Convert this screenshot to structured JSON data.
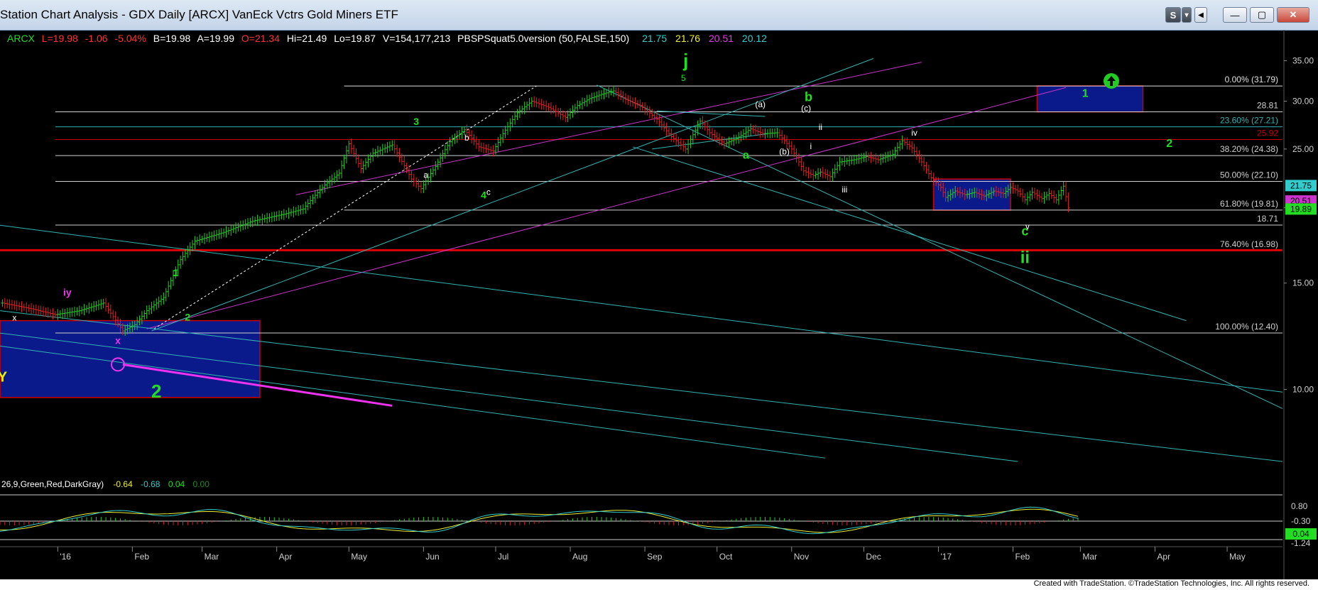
{
  "window": {
    "title": "Station Chart Analysis - GDX Daily [ARCX] VanEck Vctrs Gold Miners ETF",
    "buttons": {
      "s": "S",
      "dd": "▾",
      "back": "◀",
      "minimize": "—",
      "maximize": "▢",
      "close": "✕"
    }
  },
  "legend": {
    "symbol": "ARCX",
    "last": "L=19.98",
    "change": "-1.06",
    "pct": "-5.04%",
    "bid": "B=19.98",
    "ask": "A=19.99",
    "open": "O=21.34",
    "high": "Hi=21.49",
    "low": "Lo=19.87",
    "volume": "V=154,177,213",
    "study": "PBSPSquat5.0version (50,FALSE,150)",
    "study_vals": [
      "21.75",
      "21.76",
      "20.51",
      "20.12"
    ]
  },
  "indicator": {
    "label": "26,9,Green,Red,DarkGray)",
    "vals": [
      "-0.64",
      "-0.68",
      "0.04",
      "0.00"
    ]
  },
  "footer": {
    "credit": "Created with TradeStation. ©TradeStation Technologies, Inc. All rights reserved."
  },
  "colors": {
    "up": "#22cc22",
    "cyan": "#33b3b3",
    "magenta": "#cc33cc",
    "red": "#cc0000",
    "blue_box": "#0a1a8a"
  },
  "chart_data": {
    "type": "line",
    "title": "GDX Daily [ARCX] VanEck Vctrs Gold Miners ETF",
    "y_scale": "log",
    "ylim": [
      7.2,
      36.5
    ],
    "y_ticks": [
      {
        "v": 35,
        "label": "35.00"
      },
      {
        "v": 30,
        "label": "30.00"
      },
      {
        "v": 25,
        "label": "25.00"
      },
      {
        "v": 20,
        "label": "20.00"
      },
      {
        "v": 15,
        "label": "15.00"
      },
      {
        "v": 10,
        "label": "10.00"
      }
    ],
    "x_ticks": [
      {
        "label": "'16",
        "t": 1.0
      },
      {
        "label": "Feb",
        "t": 32.0
      },
      {
        "label": "Mar",
        "t": 61.0
      },
      {
        "label": "Apr",
        "t": 92.0
      },
      {
        "label": "May",
        "t": 122.0
      },
      {
        "label": "Jun",
        "t": 153.0
      },
      {
        "label": "Jul",
        "t": 183.0
      },
      {
        "label": "Aug",
        "t": 214.0
      },
      {
        "label": "Sep",
        "t": 245.0
      },
      {
        "label": "Oct",
        "t": 275.0
      },
      {
        "label": "Nov",
        "t": 306.0
      },
      {
        "label": "Dec",
        "t": 336.0
      },
      {
        "label": "'17",
        "t": 367.0
      },
      {
        "label": "Feb",
        "t": 398.0
      },
      {
        "label": "Mar",
        "t": 426.0
      },
      {
        "label": "Apr",
        "t": 457.0
      },
      {
        "label": "May",
        "t": 487.0
      }
    ],
    "x_range": [
      -23,
      510
    ],
    "close_path": [
      [
        -22,
        13.9
      ],
      [
        -10,
        13.6
      ],
      [
        0,
        13.3
      ],
      [
        10,
        13.5
      ],
      [
        20,
        13.9
      ],
      [
        28,
        12.5
      ],
      [
        33,
        12.8
      ],
      [
        38,
        13.5
      ],
      [
        45,
        14.2
      ],
      [
        52,
        16.4
      ],
      [
        58,
        17.6
      ],
      [
        70,
        18.2
      ],
      [
        82,
        19.0
      ],
      [
        95,
        19.5
      ],
      [
        103,
        19.9
      ],
      [
        112,
        21.8
      ],
      [
        118,
        22.8
      ],
      [
        122,
        25.5
      ],
      [
        127,
        23.2
      ],
      [
        132,
        24.6
      ],
      [
        140,
        25.4
      ],
      [
        148,
        22.3
      ],
      [
        152,
        21.5
      ],
      [
        158,
        23.4
      ],
      [
        164,
        25.7
      ],
      [
        170,
        26.9
      ],
      [
        176,
        25.2
      ],
      [
        182,
        24.8
      ],
      [
        186,
        26.5
      ],
      [
        192,
        28.7
      ],
      [
        198,
        30.0
      ],
      [
        205,
        29.3
      ],
      [
        212,
        28.2
      ],
      [
        217,
        29.5
      ],
      [
        222,
        30.3
      ],
      [
        227,
        30.8
      ],
      [
        232,
        31.2
      ],
      [
        237,
        30.2
      ],
      [
        243,
        29.5
      ],
      [
        250,
        28.0
      ],
      [
        256,
        26.2
      ],
      [
        262,
        25.0
      ],
      [
        268,
        27.8
      ],
      [
        272,
        26.6
      ],
      [
        278,
        25.5
      ],
      [
        283,
        26.0
      ],
      [
        289,
        27.0
      ],
      [
        294,
        26.5
      ],
      [
        300,
        26.6
      ],
      [
        306,
        25.0
      ],
      [
        311,
        23.0
      ],
      [
        315,
        22.6
      ],
      [
        318,
        22.9
      ],
      [
        322,
        22.5
      ],
      [
        326,
        23.8
      ],
      [
        332,
        24.0
      ],
      [
        337,
        24.3
      ],
      [
        342,
        24.0
      ],
      [
        348,
        24.5
      ],
      [
        352,
        25.8
      ],
      [
        356,
        25.1
      ],
      [
        360,
        23.8
      ],
      [
        364,
        22.4
      ],
      [
        368,
        21.6
      ],
      [
        370,
        20.8
      ],
      [
        374,
        21.3
      ],
      [
        378,
        21.0
      ],
      [
        382,
        21.2
      ],
      [
        386,
        20.9
      ],
      [
        390,
        21.3
      ],
      [
        394,
        21.1
      ],
      [
        397,
        21.6
      ],
      [
        400,
        21.3
      ],
      [
        403,
        20.6
      ],
      [
        406,
        21.2
      ],
      [
        410,
        20.7
      ],
      [
        413,
        21.1
      ],
      [
        416,
        20.6
      ],
      [
        419,
        21.7
      ],
      [
        421,
        19.98
      ]
    ],
    "hlines": [
      {
        "v": 31.79,
        "label": "0.00% (31.79)",
        "color": "#e0e0e0",
        "x0": 120
      },
      {
        "v": 28.81,
        "label": "28.81",
        "color": "#cfcfcf",
        "x0": 0
      },
      {
        "v": 27.21,
        "label": "23.60% (27.21)",
        "color": "#33b3b3",
        "x0": 0
      },
      {
        "v": 25.92,
        "label": "25.92",
        "color": "#cc0000",
        "x0": 0
      },
      {
        "v": 24.38,
        "label": "38.20% (24.38)",
        "color": "#cfcfcf",
        "x0": 0
      },
      {
        "v": 22.1,
        "label": "50.00% (22.10)",
        "color": "#cfcfcf",
        "x0": 0
      },
      {
        "v": 19.81,
        "label": "61.80% (19.81)",
        "color": "#cfcfcf",
        "x0": 120
      },
      {
        "v": 18.71,
        "label": "18.71",
        "color": "#cfcfcf",
        "x0": 0
      },
      {
        "v": 16.98,
        "label": "76.40% (16.98)",
        "color": "#cfcfcf",
        "x0": 0
      },
      {
        "v": 12.4,
        "label": "100.00% (12.40)",
        "color": "#cfcfcf",
        "x0": 0
      }
    ],
    "thick_hline": {
      "v": 17.0,
      "color": "#dd0000"
    },
    "axis_tags": [
      {
        "v": 21.75,
        "label": "21.75",
        "bg": "#33cccc",
        "fg": "#000"
      },
      {
        "v": 20.51,
        "label": "20.51",
        "bg": "#cc33cc",
        "fg": "#000"
      },
      {
        "v": 19.89,
        "label": "19.89",
        "bg": "#22dd22",
        "fg": "#000"
      }
    ],
    "trendlines": [
      {
        "p": [
          [
            100,
            21.0
          ],
          [
            360,
            34.8
          ]
        ],
        "color": "#cc33cc",
        "w": 1
      },
      {
        "p": [
          [
            38,
            12.6
          ],
          [
            420,
            31.6
          ]
        ],
        "color": "#cc33cc",
        "w": 1
      },
      {
        "p": [
          [
            40,
            12.5
          ],
          [
            340,
            35.3
          ]
        ],
        "color": "#33b3b3",
        "w": 1
      },
      {
        "p": [
          [
            41,
            12.6
          ],
          [
            200,
            31.8
          ]
        ],
        "color": "#ffffff",
        "w": 1,
        "dash": true
      },
      {
        "p": [
          [
            225,
            31.9
          ],
          [
            510,
            9.3
          ]
        ],
        "color": "#33b3b3",
        "w": 1
      },
      {
        "p": [
          [
            240,
            25.2
          ],
          [
            470,
            13.0
          ]
        ],
        "color": "#33b3b3",
        "w": 1
      },
      {
        "p": [
          [
            248,
            25.0
          ],
          [
            296,
            26.5
          ]
        ],
        "color": "#33b3b3",
        "w": 1
      },
      {
        "p": [
          [
            250,
            28.9
          ],
          [
            295,
            28.3
          ]
        ],
        "color": "#33b3b3",
        "w": 1
      },
      {
        "p": [
          [
            -23,
            18.7
          ],
          [
            510,
            9.9
          ]
        ],
        "color": "#33b3b3",
        "w": 1
      },
      {
        "p": [
          [
            -23,
            13.5
          ],
          [
            510,
            7.6
          ]
        ],
        "color": "#33b3b3",
        "w": 1
      },
      {
        "p": [
          [
            -23,
            12.4
          ],
          [
            400,
            7.6
          ]
        ],
        "color": "#33b3b3",
        "w": 1
      },
      {
        "p": [
          [
            -23,
            11.8
          ],
          [
            320,
            7.7
          ]
        ],
        "color": "#33b3b3",
        "w": 1
      },
      {
        "p": [
          [
            28,
            11.0
          ],
          [
            140,
            9.4
          ]
        ],
        "color": "#ee33ee",
        "w": 3
      }
    ],
    "boxes": [
      {
        "x0": -23,
        "x1": 85,
        "v0": 9.7,
        "v1": 13.0,
        "fill": "#0a1a8a",
        "stroke": "#cc0000"
      },
      {
        "x0": 365,
        "x1": 397,
        "v0": 19.8,
        "v1": 22.3,
        "fill": "#0a1a8a",
        "stroke": "#cc0000"
      },
      {
        "x0": 408,
        "x1": 452,
        "v0": 28.8,
        "v1": 31.8,
        "fill": "#0a1a8a",
        "stroke": "#cc0000"
      }
    ],
    "annotations": [
      {
        "t": "j",
        "x": 262,
        "v": 34.2,
        "c": "#22dd22",
        "s": 26,
        "b": true
      },
      {
        "t": "5",
        "x": 261,
        "v": 32.4,
        "c": "#22dd22",
        "s": 12
      },
      {
        "t": "3",
        "x": 150,
        "v": 27.4,
        "c": "#22dd22",
        "s": 14,
        "b": true
      },
      {
        "t": "4",
        "x": 178,
        "v": 20.7,
        "c": "#22dd22",
        "s": 14,
        "b": true
      },
      {
        "t": "1",
        "x": 50,
        "v": 15.4,
        "c": "#22dd22",
        "s": 14,
        "b": true
      },
      {
        "t": "2",
        "x": 55,
        "v": 13.0,
        "c": "#22dd22",
        "s": 14,
        "b": true
      },
      {
        "t": "2",
        "x": 42,
        "v": 9.7,
        "c": "#22dd22",
        "s": 26,
        "b": true
      },
      {
        "t": "a",
        "x": 287,
        "v": 24.1,
        "c": "#22dd22",
        "s": 16,
        "b": true
      },
      {
        "t": "b",
        "x": 313,
        "v": 30.0,
        "c": "#22dd22",
        "s": 18,
        "b": true
      },
      {
        "t": "c",
        "x": 403,
        "v": 18.0,
        "c": "#22dd22",
        "s": 18,
        "b": true
      },
      {
        "t": "ii",
        "x": 403,
        "v": 16.2,
        "c": "#22dd22",
        "s": 24,
        "b": true
      },
      {
        "t": "2",
        "x": 463,
        "v": 25.2,
        "c": "#22dd22",
        "s": 16,
        "b": true
      },
      {
        "t": "1",
        "x": 428,
        "v": 30.5,
        "c": "#22dd22",
        "s": 16,
        "b": true
      },
      {
        "t": "iv",
        "x": 357,
        "v": 26.3,
        "c": "#ffffff",
        "s": 12
      },
      {
        "t": "iii",
        "x": 328,
        "v": 21.2,
        "c": "#ffffff",
        "s": 12
      },
      {
        "t": "v",
        "x": 404,
        "v": 18.4,
        "c": "#ffffff",
        "s": 12
      },
      {
        "t": "i",
        "x": 314,
        "v": 25.0,
        "c": "#ffffff",
        "s": 12
      },
      {
        "t": "ii",
        "x": 318,
        "v": 26.9,
        "c": "#ffffff",
        "s": 12
      },
      {
        "t": "(a)",
        "x": 293,
        "v": 29.3,
        "c": "#ffffff",
        "s": 12
      },
      {
        "t": "(b)",
        "x": 303,
        "v": 24.5,
        "c": "#ffffff",
        "s": 12
      },
      {
        "t": "(c)",
        "x": 312,
        "v": 28.9,
        "c": "#ffffff",
        "s": 12
      },
      {
        "t": "b",
        "x": 171,
        "v": 25.8,
        "c": "#ffffff",
        "s": 12
      },
      {
        "t": "a",
        "x": 154,
        "v": 22.4,
        "c": "#ffffff",
        "s": 12
      },
      {
        "t": "c",
        "x": 180,
        "v": 21.0,
        "c": "#ffffff",
        "s": 12
      },
      {
        "t": "x",
        "x": -17,
        "v": 13.0,
        "c": "#ffffff",
        "s": 12
      },
      {
        "t": "iy",
        "x": 5,
        "v": 14.3,
        "c": "#ee33ee",
        "s": 14,
        "b": true
      },
      {
        "t": "x",
        "x": 26,
        "v": 11.9,
        "c": "#ee33ee",
        "s": 14,
        "b": true
      },
      {
        "t": "Y",
        "x": -22,
        "v": 10.3,
        "c": "#eeee00",
        "s": 20,
        "b": true
      }
    ]
  }
}
